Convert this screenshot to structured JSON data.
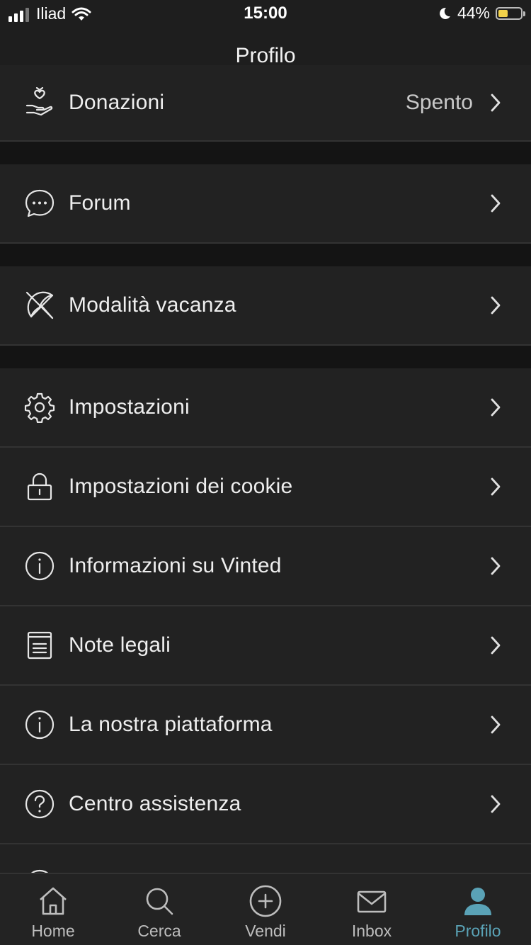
{
  "status_bar": {
    "carrier": "Iliad",
    "time": "15:00",
    "battery": "44%",
    "battery_level": 0.44,
    "battery_color": "#f2d24b"
  },
  "header": {
    "title": "Profilo"
  },
  "menu": {
    "donazioni": {
      "label": "Donazioni",
      "value": "Spento",
      "icon": "hand-heart-icon"
    },
    "forum": {
      "label": "Forum",
      "icon": "chat-bubble-icon"
    },
    "vacanza": {
      "label": "Modalità vacanza",
      "icon": "umbrella-off-icon"
    },
    "impostazioni": {
      "label": "Impostazioni",
      "icon": "gear-icon"
    },
    "cookie": {
      "label": "Impostazioni dei cookie",
      "icon": "lock-icon"
    },
    "info": {
      "label": "Informazioni su Vinted",
      "icon": "info-icon"
    },
    "note": {
      "label": "Note legali",
      "icon": "document-icon"
    },
    "piattaforma": {
      "label": "La nostra piattaforma",
      "icon": "info-icon"
    },
    "assistenza": {
      "label": "Centro assistenza",
      "icon": "question-icon"
    }
  },
  "tabbar": {
    "home": "Home",
    "cerca": "Cerca",
    "vendi": "Vendi",
    "inbox": "Inbox",
    "profilo": "Profilo",
    "active_color": "#5aa2b6"
  }
}
